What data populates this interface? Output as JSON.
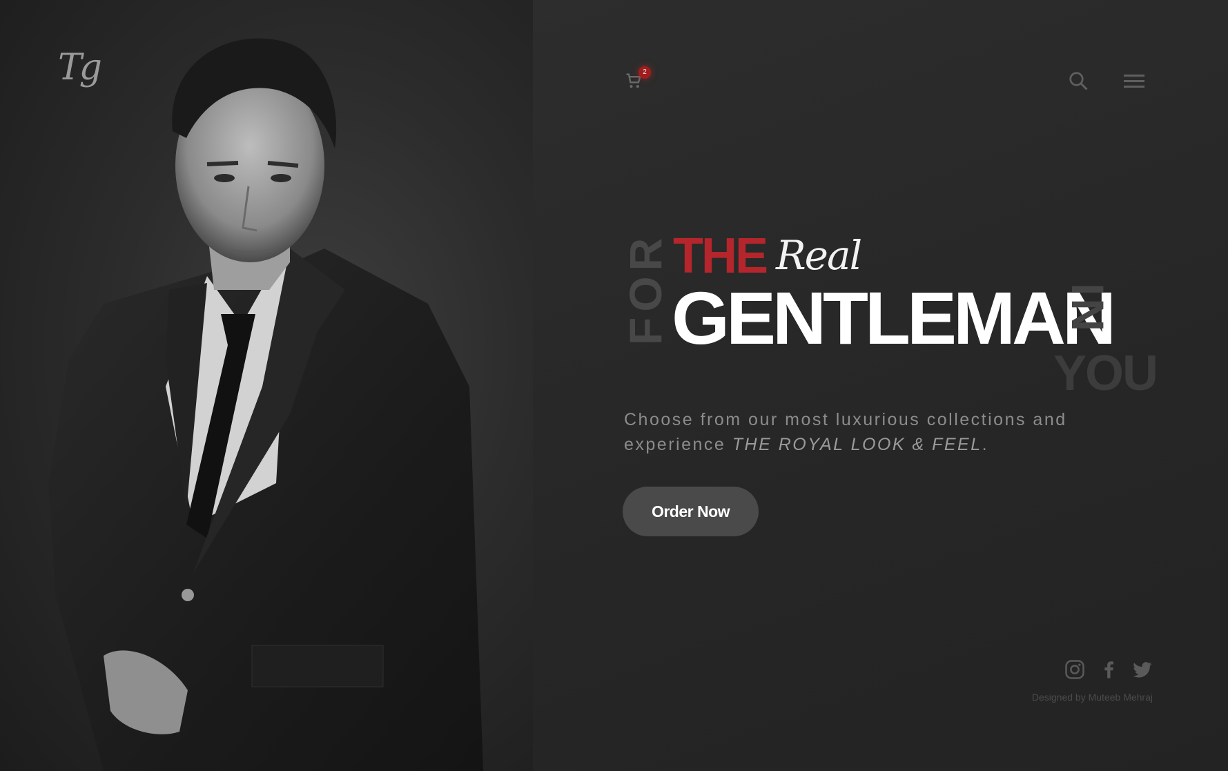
{
  "brand": {
    "logo_text": "Tg"
  },
  "header": {
    "cart_count": "2",
    "cart_icon": "cart-icon",
    "search_icon": "search-icon",
    "menu_icon": "hamburger-menu-icon"
  },
  "hero": {
    "for_word": "FOR",
    "the_word": "THE",
    "real_word": "Real",
    "gentleman_word": "GENTLEMAN",
    "in_word": "IN",
    "you_word": "YOU",
    "tagline_plain": "Choose from our most luxurious collections and experience ",
    "tagline_emphasis": "THE ROYAL LOOK & FEEL",
    "tagline_end": ".",
    "cta_label": "Order Now"
  },
  "footer": {
    "social": [
      "instagram-icon",
      "facebook-icon",
      "twitter-icon"
    ],
    "credit": "Designed by Muteeb Mehraj"
  },
  "colors": {
    "accent": "#b4262b",
    "background": "#262626",
    "button": "#4a4a4a"
  }
}
